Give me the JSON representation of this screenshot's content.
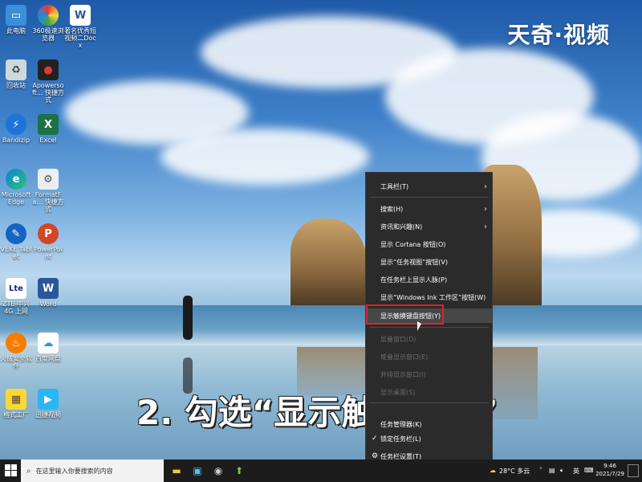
{
  "brand": {
    "text": "天奇·视频"
  },
  "caption": {
    "text": "2. 勾选“显示触摸按钮”"
  },
  "desktop_icons": [
    {
      "label": "此电脑"
    },
    {
      "label": "360极速浏览器"
    },
    {
      "label": "著名优秀短视频二Docx"
    },
    {
      "label": "回收站"
    },
    {
      "label": "Apowersoft... 快捷方式"
    },
    {
      "label": "Bandizip"
    },
    {
      "label": "Excel"
    },
    {
      "label": "Microsoft Edge"
    },
    {
      "label": "FormatFa... 快捷方式"
    },
    {
      "label": "VEKE Tablet"
    },
    {
      "label": "PowerPoint"
    },
    {
      "label": "ZTE 中兴 4G 上网"
    },
    {
      "label": "Word"
    },
    {
      "label": "火绒安全软件"
    },
    {
      "label": "百度网盘"
    },
    {
      "label": "格式工厂"
    },
    {
      "label": "迅捷视频"
    }
  ],
  "context_menu": {
    "items": [
      {
        "label": "工具栏(T)",
        "submenu": true,
        "disabled": false
      },
      {
        "label": "搜索(H)",
        "submenu": true,
        "disabled": false
      },
      {
        "label": "资讯和兴趣(N)",
        "submenu": true,
        "disabled": false
      },
      {
        "label": "显示 Cortana 按钮(O)",
        "disabled": false
      },
      {
        "label": "显示“任务视图”按钮(V)",
        "disabled": false
      },
      {
        "label": "在任务栏上显示人脉(P)",
        "disabled": false
      },
      {
        "label": "显示“Windows Ink 工作区”按钮(W)",
        "disabled": false
      },
      {
        "label": "显示触摸键盘按钮(Y)",
        "disabled": false,
        "hover": true
      },
      {
        "label": "层叠窗口(D)",
        "disabled": true
      },
      {
        "label": "堆叠显示窗口(E)",
        "disabled": true
      },
      {
        "label": "并排显示窗口(I)",
        "disabled": true
      },
      {
        "label": "显示桌面(S)",
        "disabled": true
      },
      {
        "label": "任务管理器(K)",
        "disabled": false
      },
      {
        "label": "锁定任务栏(L)",
        "checked": true,
        "disabled": false
      },
      {
        "label": "任务栏设置(T)",
        "disabled": false
      }
    ]
  },
  "taskbar": {
    "search_placeholder": "在这里输入你要搜索的内容",
    "weather": "28°C 多云",
    "ime": "英",
    "time": "9:46",
    "date": "2021/7/29"
  },
  "colors": {
    "highlight": "#e0222a",
    "menu_bg": "#2b2b2b",
    "taskbar": "#1c1c1c"
  }
}
